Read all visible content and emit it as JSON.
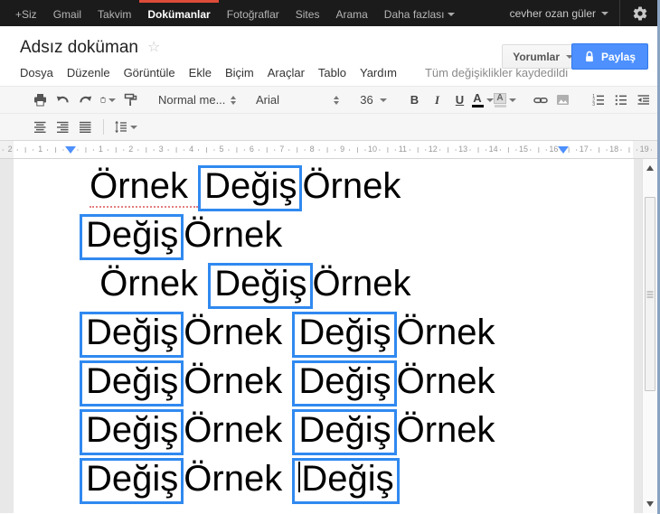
{
  "topbar": {
    "items": [
      {
        "label": "+Siz"
      },
      {
        "label": "Gmail"
      },
      {
        "label": "Takvim"
      },
      {
        "label": "Dokümanlar",
        "active": true
      },
      {
        "label": "Fotoğraflar"
      },
      {
        "label": "Sites"
      },
      {
        "label": "Arama"
      },
      {
        "label": "Daha fazlası",
        "dropdown": true
      }
    ],
    "user": "cevher ozan güler",
    "background_color": "#1b1b1b",
    "active_accent_color": "#dd4b39"
  },
  "header": {
    "title": "Adsız doküman",
    "star_icon": "☆",
    "comments_button_label": "Yorumlar",
    "share_button_label": "Paylaş",
    "share_button_color": "#4d90fe",
    "menus": [
      "Dosya",
      "Düzenle",
      "Görüntüle",
      "Ekle",
      "Biçim",
      "Araçlar",
      "Tablo",
      "Yardım"
    ],
    "save_status": "Tüm değişiklikler kaydedildi"
  },
  "toolbar": {
    "style_value": "Normal me...",
    "font_value": "Arial",
    "size_value": "36",
    "bold_label": "B",
    "italic_label": "I",
    "underline_label": "U",
    "text_color_label": "A",
    "highlight_label": "A"
  },
  "ruler": {
    "numbers": [
      "2",
      "1",
      "1",
      "2",
      "3",
      "4",
      "5",
      "6",
      "7",
      "8",
      "9",
      "10",
      "11",
      "12",
      "13",
      "14",
      "15",
      "16",
      "17",
      "18",
      "19"
    ],
    "margin_marker_color": "#4d90fe"
  },
  "document": {
    "highlight_box_color": "#3089f0",
    "lines": [
      {
        "segments": [
          {
            "text": " "
          },
          {
            "text": "Örnek ",
            "spell": true
          },
          {
            "text": "Değiş",
            "boxed": true
          },
          {
            "text": "Örnek"
          }
        ]
      },
      {
        "segments": [
          {
            "text": "Değiş",
            "boxed": true
          },
          {
            "text": "Örnek"
          }
        ]
      },
      {
        "segments": [
          {
            "text": "  "
          },
          {
            "text": "Örnek "
          },
          {
            "text": "Değiş",
            "boxed": true
          },
          {
            "text": "Örnek"
          }
        ]
      },
      {
        "segments": [
          {
            "text": "Değiş",
            "boxed": true
          },
          {
            "text": "Örnek "
          },
          {
            "text": "Değiş",
            "boxed": true
          },
          {
            "text": "Örnek"
          }
        ]
      },
      {
        "segments": [
          {
            "text": "Değiş",
            "boxed": true
          },
          {
            "text": "Örnek "
          },
          {
            "text": "Değiş",
            "boxed": true
          },
          {
            "text": "Örnek"
          }
        ]
      },
      {
        "segments": [
          {
            "text": "Değiş",
            "boxed": true
          },
          {
            "text": "Örnek "
          },
          {
            "text": "Değiş",
            "boxed": true
          },
          {
            "text": "Örnek"
          }
        ]
      },
      {
        "segments": [
          {
            "text": "Değiş",
            "boxed": true
          },
          {
            "text": "Örnek "
          },
          {
            "text": "Değiş",
            "boxed": true,
            "caret": true
          }
        ]
      }
    ]
  }
}
